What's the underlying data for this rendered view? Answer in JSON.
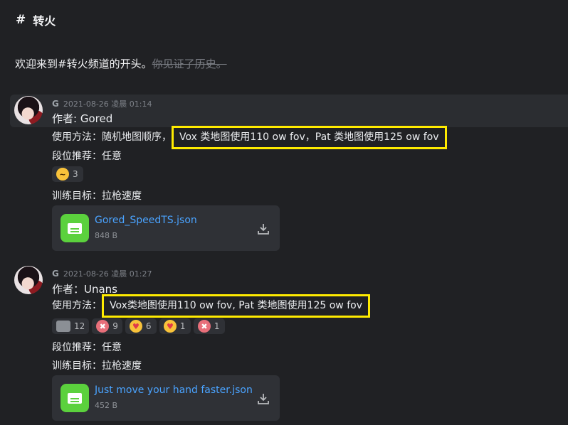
{
  "channel": {
    "name": "转火",
    "hash": "#"
  },
  "welcome": {
    "text": "欢迎来到#转火频道的开头。",
    "strike": "你见证了历史。"
  },
  "messages": [
    {
      "author": "G",
      "timestamp": "2021-08-26 凌晨 01:14",
      "lines": {
        "author_line": "作者: Gored",
        "usage_prefix": "使用方法：随机地图顺序，",
        "usage_highlight": "Vox 类地图使用110 ow fov，Pat 类地图使用125 ow fov",
        "rank": "段位推荐：任意",
        "goal": "训练目标：拉枪速度"
      },
      "reactions": [
        {
          "emoji": "laughing-emoji",
          "count": "3"
        }
      ],
      "attachment": {
        "name": "Gored_SpeedTS.json",
        "size": "848 B"
      }
    },
    {
      "author": "G",
      "timestamp": "2021-08-26 凌晨 01:27",
      "lines": {
        "author_line": "作者：Unans",
        "usage_prefix": "使用方法：",
        "usage_highlight": "Vox类地图使用110 ow fov, Pat 类地图使用125 ow fov",
        "rank": "段位推荐：任意",
        "goal": "训练目标：拉枪速度"
      },
      "reactions": [
        {
          "emoji": "custom-face-emoji",
          "count": "12"
        },
        {
          "emoji": "angry-face-emoji",
          "count": "9"
        },
        {
          "emoji": "heart-eyes-emoji",
          "count": "6"
        },
        {
          "emoji": "heart-eyes-emoji",
          "count": "1"
        },
        {
          "emoji": "angry-face-emoji",
          "count": "1"
        }
      ],
      "attachment": {
        "name": "Just move your hand faster.json",
        "size": "452 B"
      }
    }
  ],
  "colors": {
    "highlight": "#ffeb00",
    "file_icon": "#5bd13d",
    "link": "#4aa3ff"
  }
}
